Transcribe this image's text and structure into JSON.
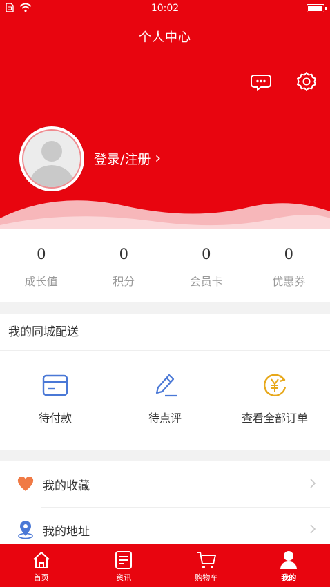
{
  "status_bar": {
    "time": "10:02"
  },
  "header": {
    "title": "个人中心",
    "message_icon": "chat-bubble-icon",
    "settings_icon": "gear-icon",
    "login_label": "登录/注册",
    "login_chevron": "›"
  },
  "stats": [
    {
      "value": "0",
      "label": "成长值"
    },
    {
      "value": "0",
      "label": "积分"
    },
    {
      "value": "0",
      "label": "会员卡"
    },
    {
      "value": "0",
      "label": "优惠券"
    }
  ],
  "delivery": {
    "title": "我的同城配送",
    "items": [
      {
        "label": "待付款",
        "icon": "card-icon"
      },
      {
        "label": "待点评",
        "icon": "pencil-icon"
      },
      {
        "label": "查看全部订单",
        "icon": "yen-refresh-icon"
      }
    ]
  },
  "menu": [
    {
      "label": "我的收藏",
      "icon": "heart-icon"
    },
    {
      "label": "我的地址",
      "icon": "location-pin-icon"
    }
  ],
  "tabbar": [
    {
      "label": "首页",
      "icon": "home-icon",
      "active": false
    },
    {
      "label": "资讯",
      "icon": "news-icon",
      "active": false
    },
    {
      "label": "购物车",
      "icon": "cart-icon",
      "active": false
    },
    {
      "label": "我的",
      "icon": "user-icon",
      "active": true
    }
  ],
  "colors": {
    "brand_red": "#e8050f",
    "icon_blue": "#4a78d6",
    "icon_gold": "#e7a81b",
    "heart_orange": "#f07a45"
  }
}
